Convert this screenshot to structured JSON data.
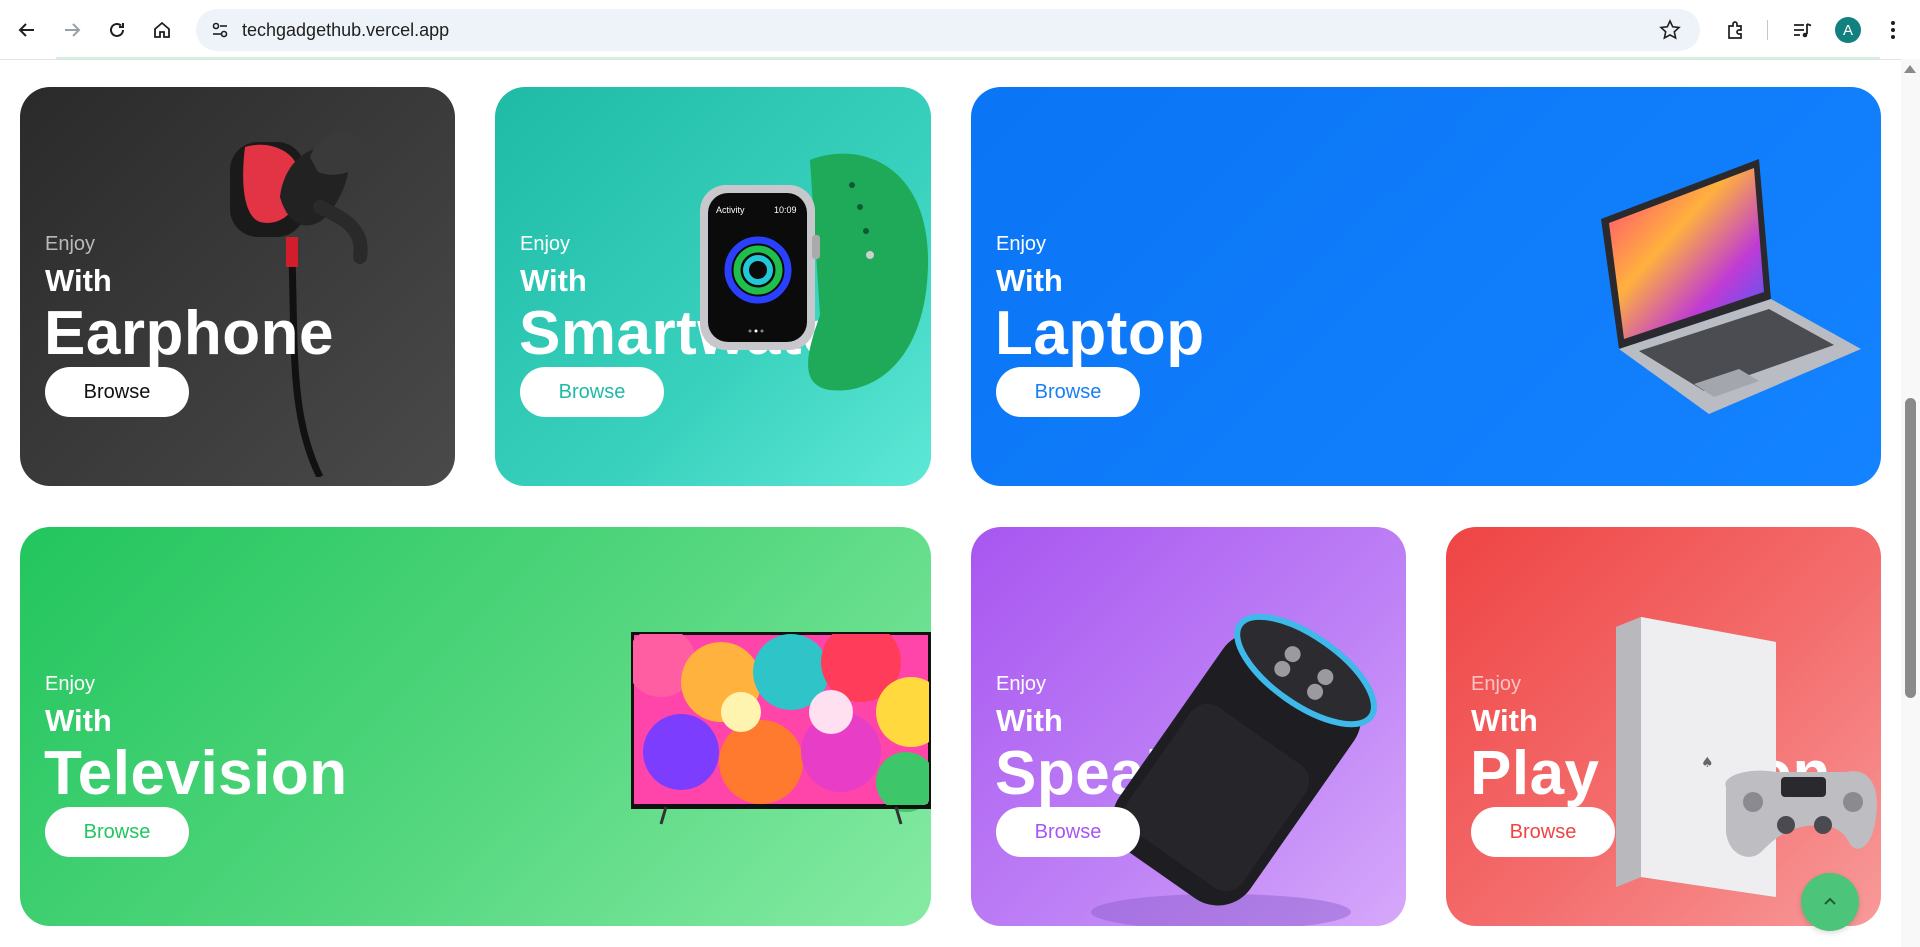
{
  "browser": {
    "url": "techgadgethub.vercel.app",
    "profile_initial": "A",
    "icons": [
      "back-arrow-icon",
      "forward-arrow-icon",
      "reload-icon",
      "home-icon",
      "site-settings-icon",
      "bookmark-star-icon",
      "extensions-icon",
      "media-controls-icon",
      "menu-kebab-icon"
    ]
  },
  "cards": [
    {
      "enjoy": "Enjoy",
      "with": "With",
      "title": "Earphone",
      "button": "Browse",
      "button_color": "#111111"
    },
    {
      "enjoy": "Enjoy",
      "with": "With",
      "title": "Smartwatch",
      "button": "Browse",
      "button_color": "#1fb9a6"
    },
    {
      "enjoy": "Enjoy",
      "with": "With",
      "title": "Laptop",
      "button": "Browse",
      "button_color": "#1a7ff5"
    },
    {
      "enjoy": "Enjoy",
      "with": "With",
      "title": "Television",
      "button": "Browse",
      "button_color": "#22c55e"
    },
    {
      "enjoy": "Enjoy",
      "with": "With",
      "title": "Speaker",
      "button": "Browse",
      "button_color": "#a855f7"
    },
    {
      "enjoy": "Enjoy",
      "with": "With",
      "title": "Play Station",
      "button": "Browse",
      "button_color": "#ef4444"
    }
  ],
  "watch_screen": {
    "app": "Activity",
    "time": "10:09"
  },
  "colors": {
    "earphone_bg": "#2f2f2f",
    "smartwatch_bg": "#2cc6b2",
    "laptop_bg": "#0f7ffa",
    "television_bg": "#4ed37a",
    "speaker_bg": "#b978f5",
    "playstation_bg": "#f26363",
    "scroll_top_button": "#4cc47a"
  },
  "scroll_top_icon": "chevron-up-icon"
}
